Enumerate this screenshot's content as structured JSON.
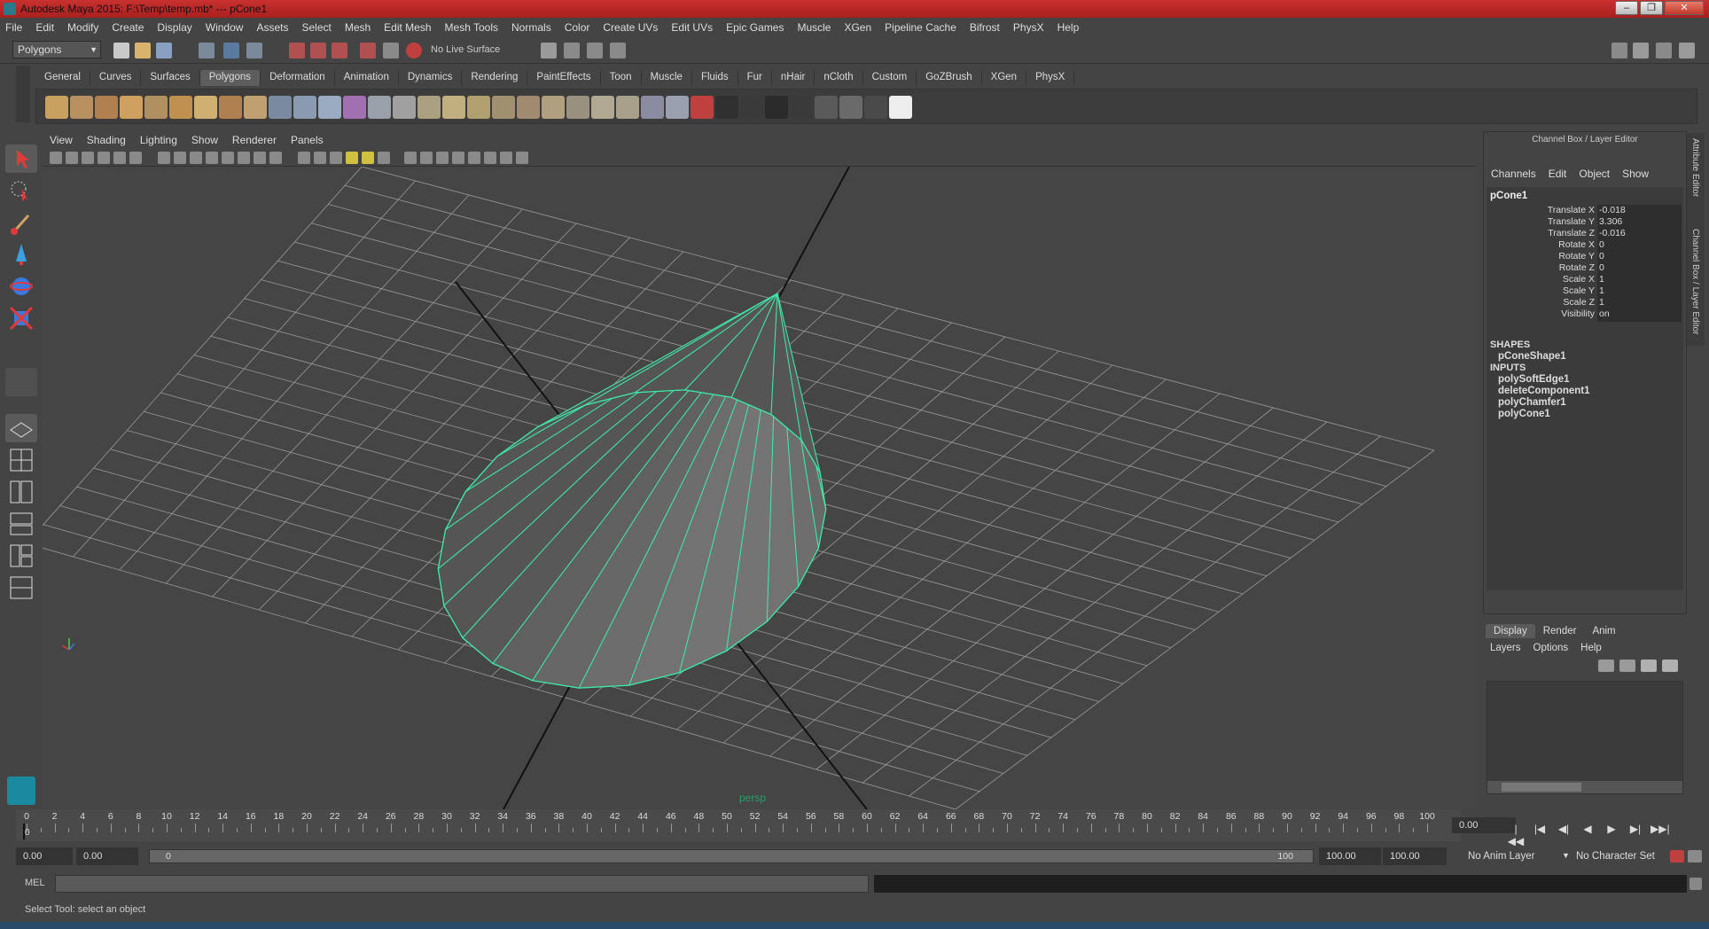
{
  "window": {
    "title": "Autodesk Maya 2015: F:\\Temp\\temp.mb*   ---   pCone1"
  },
  "menubar": [
    "File",
    "Edit",
    "Modify",
    "Create",
    "Display",
    "Window",
    "Assets",
    "Select",
    "Mesh",
    "Edit Mesh",
    "Mesh Tools",
    "Normals",
    "Color",
    "Create UVs",
    "Edit UVs",
    "Epic Games",
    "Muscle",
    "XGen",
    "Pipeline Cache",
    "Bifrost",
    "PhysX",
    "Help"
  ],
  "status_line": {
    "mode": "Polygons",
    "live_surface": "No Live Surface"
  },
  "shelf_tabs": [
    {
      "label": "General"
    },
    {
      "label": "Curves"
    },
    {
      "label": "Surfaces"
    },
    {
      "label": "Polygons",
      "active": true
    },
    {
      "label": "Deformation"
    },
    {
      "label": "Animation"
    },
    {
      "label": "Dynamics"
    },
    {
      "label": "Rendering"
    },
    {
      "label": "PaintEffects"
    },
    {
      "label": "Toon"
    },
    {
      "label": "Muscle"
    },
    {
      "label": "Fluids"
    },
    {
      "label": "Fur"
    },
    {
      "label": "nHair"
    },
    {
      "label": "nCloth"
    },
    {
      "label": "Custom"
    },
    {
      "label": "GoZBrush"
    },
    {
      "label": "XGen"
    },
    {
      "label": "PhysX"
    }
  ],
  "viewport": {
    "menu": [
      "View",
      "Shading",
      "Lighting",
      "Show",
      "Renderer",
      "Panels"
    ],
    "camera_label": "persp",
    "selection_color": "#3ee8a6",
    "grid_color": "#9a9a9a",
    "background_color": "#454545"
  },
  "channel_box": {
    "header": "Channel Box / Layer Editor",
    "menu": [
      "Channels",
      "Edit",
      "Object",
      "Show"
    ],
    "object": "pCone1",
    "channels": [
      {
        "label": "Translate X",
        "value": "-0.018"
      },
      {
        "label": "Translate Y",
        "value": "3.306"
      },
      {
        "label": "Translate Z",
        "value": "-0.016"
      },
      {
        "label": "Rotate X",
        "value": "0"
      },
      {
        "label": "Rotate Y",
        "value": "0"
      },
      {
        "label": "Rotate Z",
        "value": "0"
      },
      {
        "label": "Scale X",
        "value": "1"
      },
      {
        "label": "Scale Y",
        "value": "1"
      },
      {
        "label": "Scale Z",
        "value": "1"
      },
      {
        "label": "Visibility",
        "value": "on"
      }
    ],
    "shapes_header": "SHAPES",
    "shapes": [
      "pConeShape1"
    ],
    "inputs_header": "INPUTS",
    "inputs": [
      "polySoftEdge1",
      "deleteComponent1",
      "polyChamfer1",
      "polyCone1"
    ]
  },
  "side_tabs": [
    "Attribute Editor",
    "Channel Box / Layer Editor"
  ],
  "layer_editor": {
    "tabs": [
      {
        "label": "Display",
        "active": true
      },
      {
        "label": "Render"
      },
      {
        "label": "Anim"
      }
    ],
    "menu": [
      "Layers",
      "Options",
      "Help"
    ]
  },
  "time_slider": {
    "ticks": [
      "0",
      "2",
      "4",
      "6",
      "8",
      "10",
      "12",
      "14",
      "16",
      "18",
      "20",
      "22",
      "24",
      "26",
      "28",
      "30",
      "32",
      "34",
      "36",
      "38",
      "40",
      "42",
      "44",
      "46",
      "48",
      "50",
      "52",
      "54",
      "56",
      "58",
      "60",
      "62",
      "64",
      "66",
      "68",
      "70",
      "72",
      "74",
      "76",
      "78",
      "80",
      "82",
      "84",
      "86",
      "88",
      "90",
      "92",
      "94",
      "96",
      "98",
      "100"
    ],
    "current_frame": "0.00",
    "current_marker": "0"
  },
  "range_slider": {
    "start_a": "0.00",
    "start_b": "0.00",
    "range_start": "0",
    "range_end": "100",
    "end_a": "100.00",
    "end_b": "100.00",
    "anim_layer": "No Anim Layer",
    "character_set": "No Character Set"
  },
  "command_line": {
    "label": "MEL"
  },
  "help_line": {
    "text": "Select Tool: select an object"
  }
}
